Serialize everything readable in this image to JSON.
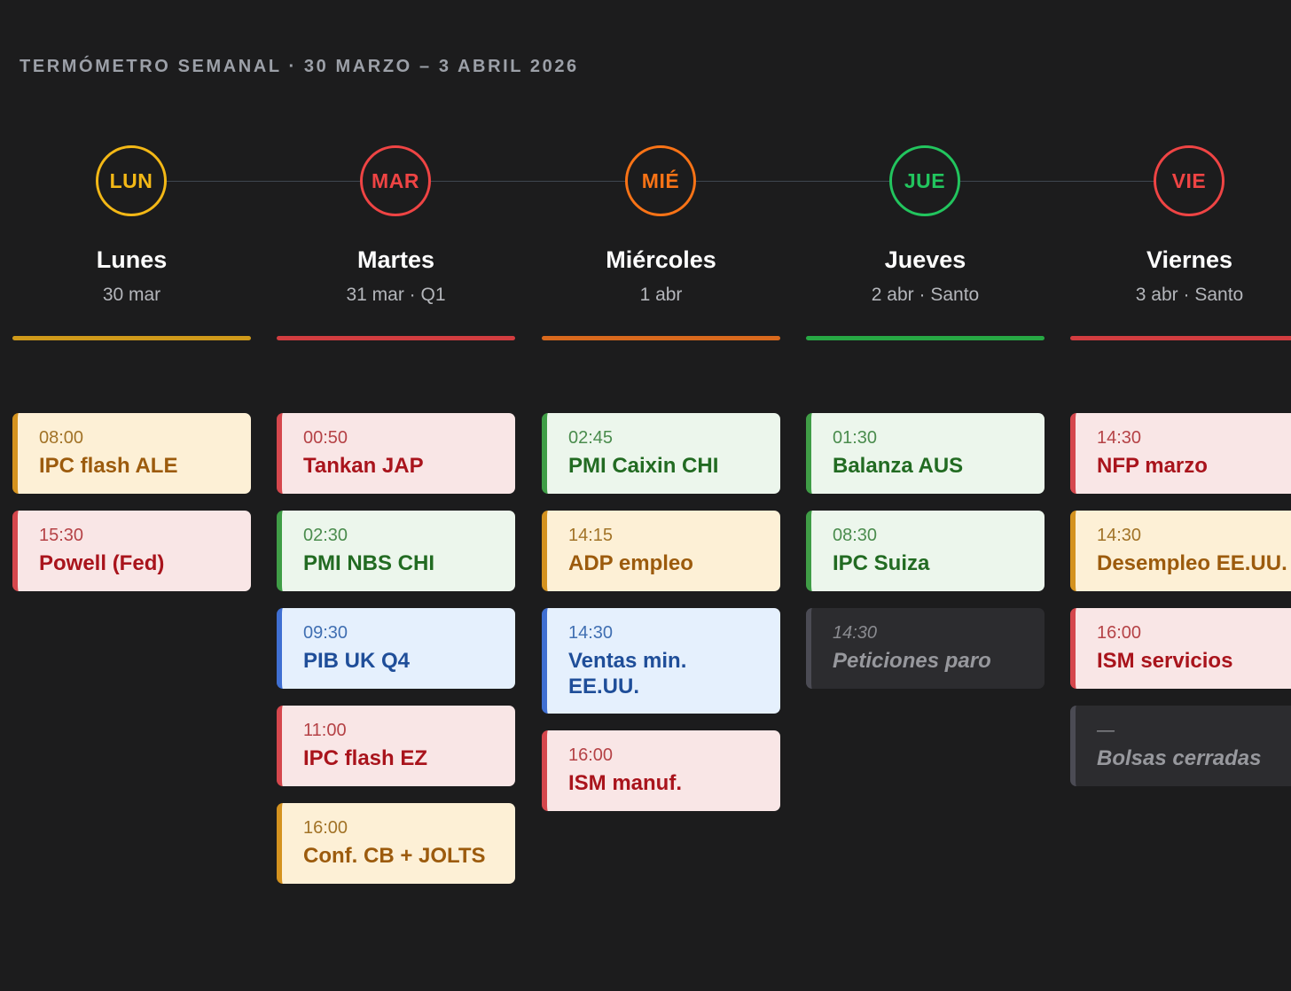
{
  "title": "TERMÓMETRO SEMANAL · 30 MARZO – 3 ABRIL 2026",
  "days": [
    {
      "abbr": "LUN",
      "name": "Lunes",
      "date": "30 mar",
      "color": "#f3b816",
      "bar_color": "#cf9a1a",
      "events": [
        {
          "time": "08:00",
          "label": "IPC flash ALE",
          "style": "yellow"
        },
        {
          "time": "15:30",
          "label": "Powell (Fed)",
          "style": "red"
        }
      ]
    },
    {
      "abbr": "MAR",
      "name": "Martes",
      "date": "31 mar · Q1",
      "color": "#ef4444",
      "bar_color": "#d23d40",
      "events": [
        {
          "time": "00:50",
          "label": "Tankan JAP",
          "style": "red"
        },
        {
          "time": "02:30",
          "label": "PMI NBS CHI",
          "style": "green"
        },
        {
          "time": "09:30",
          "label": "PIB UK Q4",
          "style": "blue"
        },
        {
          "time": "11:00",
          "label": "IPC flash EZ",
          "style": "red"
        },
        {
          "time": "16:00",
          "label": "Conf. CB + JOLTS",
          "style": "yellow"
        }
      ]
    },
    {
      "abbr": "MIÉ",
      "name": "Miércoles",
      "date": "1 abr",
      "color": "#f97316",
      "bar_color": "#d9691d",
      "events": [
        {
          "time": "02:45",
          "label": "PMI Caixin CHI",
          "style": "green"
        },
        {
          "time": "14:15",
          "label": "ADP empleo",
          "style": "yellow"
        },
        {
          "time": "14:30",
          "label": "Ventas min. EE.UU.",
          "style": "blue"
        },
        {
          "time": "16:00",
          "label": "ISM manuf.",
          "style": "red"
        }
      ]
    },
    {
      "abbr": "JUE",
      "name": "Jueves",
      "date": "2 abr · Santo",
      "color": "#22c55e",
      "bar_color": "#27a844",
      "events": [
        {
          "time": "01:30",
          "label": "Balanza AUS",
          "style": "green"
        },
        {
          "time": "08:30",
          "label": "IPC Suiza",
          "style": "green"
        },
        {
          "time": "14:30",
          "label": "Peticiones paro",
          "style": "gray"
        }
      ]
    },
    {
      "abbr": "VIE",
      "name": "Viernes",
      "date": "3 abr · Santo",
      "color": "#ef4444",
      "bar_color": "#d23d40",
      "events": [
        {
          "time": "14:30",
          "label": "NFP marzo",
          "style": "red"
        },
        {
          "time": "14:30",
          "label": "Desempleo EE.UU.",
          "style": "yellow"
        },
        {
          "time": "16:00",
          "label": "ISM servicios",
          "style": "red"
        },
        {
          "time": "—",
          "label": "Bolsas cerradas",
          "style": "gray"
        }
      ]
    }
  ]
}
